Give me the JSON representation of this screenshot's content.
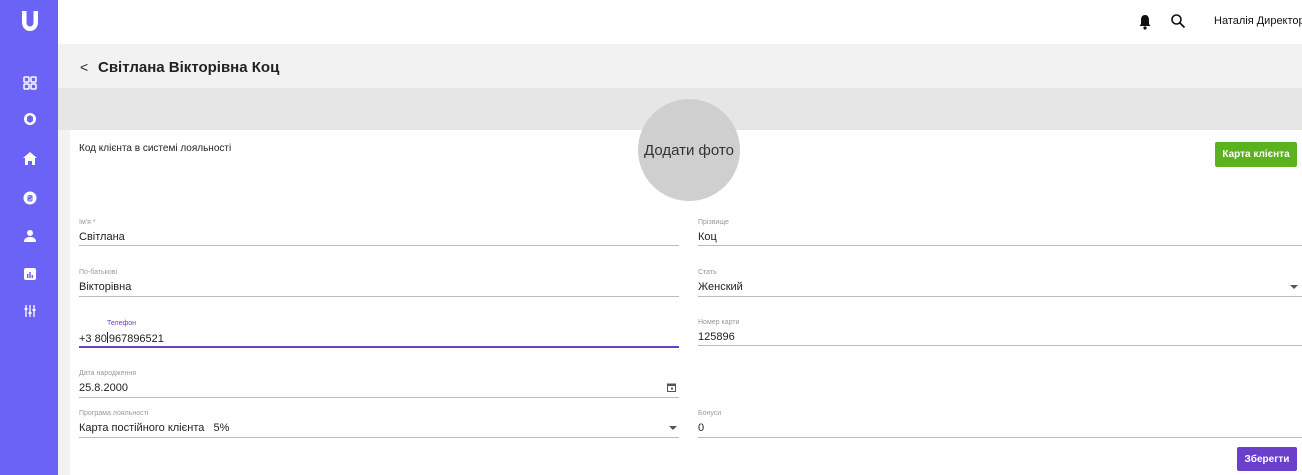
{
  "sidebar": {
    "logo": "U",
    "bg_color": "#6b63f5",
    "icons": [
      "dashboard-icon",
      "cube-icon",
      "home-icon",
      "currency-icon",
      "user-icon",
      "analytics-icon",
      "sliders-icon"
    ]
  },
  "topbar": {
    "user_name": "Наталія Директор"
  },
  "header": {
    "back": "<",
    "title": "Світлана Вікторівна Коц"
  },
  "photo": {
    "label": "Додати фото"
  },
  "loyalty_code_label": "Код клієнта в системі лояльності",
  "buttons": {
    "client_card": "Карта клієнта",
    "save": "Зберегти",
    "green": "#5ab21e",
    "purple": "#6b3fc9"
  },
  "form": {
    "first_name": {
      "label": "Ім'я *",
      "value": "Світлана"
    },
    "last_name": {
      "label": "Прізвище",
      "value": "Коц"
    },
    "patronymic": {
      "label": "По-батькові",
      "value": "Вікторівна"
    },
    "gender": {
      "label": "Стать",
      "value": "Женский"
    },
    "phone": {
      "label": "Телефон",
      "value_a": "+3 80",
      "value_b": "967896521"
    },
    "card_number": {
      "label": "Номер карти",
      "value": "125896"
    },
    "birth_date": {
      "label": "Дата народження",
      "value": "25.8.2000"
    },
    "loyalty_program": {
      "label": "Програма лояльності",
      "value": "Карта постійного клієнта   5%"
    },
    "bonuses": {
      "label": "Бонуси",
      "value": "0"
    }
  }
}
